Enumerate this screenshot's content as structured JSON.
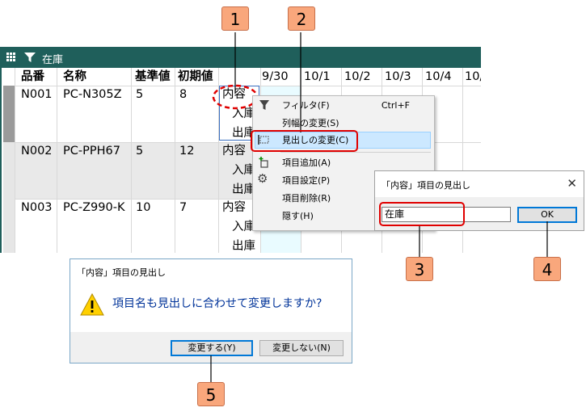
{
  "window": {
    "title": "在庫"
  },
  "grid": {
    "headers": [
      "品番",
      "名称",
      "基準値",
      "初期値"
    ],
    "dates": [
      "9/30",
      "10/1",
      "10/2",
      "10/3",
      "10/4",
      "10/"
    ],
    "rows": [
      {
        "code": "N001",
        "name": "PC-N305Z",
        "base": "5",
        "initial": "8",
        "items": [
          "内容",
          "入庫",
          "出庫"
        ]
      },
      {
        "code": "N002",
        "name": "PC-PPH67",
        "base": "5",
        "initial": "12",
        "items": [
          "内容",
          "入庫",
          "出庫"
        ]
      },
      {
        "code": "N003",
        "name": "PC-Z990-K",
        "base": "10",
        "initial": "7",
        "items": [
          "内容",
          "入庫",
          "出庫"
        ]
      }
    ]
  },
  "context_menu": {
    "items": [
      {
        "label": "フィルタ(F)",
        "shortcut": "Ctrl+F",
        "icon": "filter-icon"
      },
      {
        "label": "列幅の変更(S)",
        "shortcut": "",
        "icon": ""
      },
      {
        "label": "見出しの変更(C)",
        "shortcut": "",
        "icon": "rename-icon",
        "highlighted": true
      },
      {
        "label": "項目追加(A)",
        "shortcut": "",
        "icon": "add-item-icon"
      },
      {
        "label": "項目設定(P)",
        "shortcut": "",
        "icon": "gear-icon"
      },
      {
        "label": "項目削除(R)",
        "shortcut": "",
        "icon": ""
      },
      {
        "label": "隠す(H)",
        "shortcut": "",
        "icon": ""
      }
    ]
  },
  "rename_dialog": {
    "title": "「内容」項目の見出し",
    "value": "在庫",
    "ok_label": "OK",
    "close": "✕"
  },
  "confirm_dialog": {
    "title": "「内容」項目の見出し",
    "message": "項目名も見出しに合わせて変更しますか?",
    "yes_label": "変更する(Y)",
    "no_label": "変更しない(N)"
  },
  "callouts": [
    "1",
    "2",
    "3",
    "4",
    "5"
  ],
  "colors": {
    "titlebar": "#1f5f5b",
    "callout": "#f9a77c",
    "highlight_ring": "#e00000",
    "menu_highlight": "#cce8ff"
  }
}
